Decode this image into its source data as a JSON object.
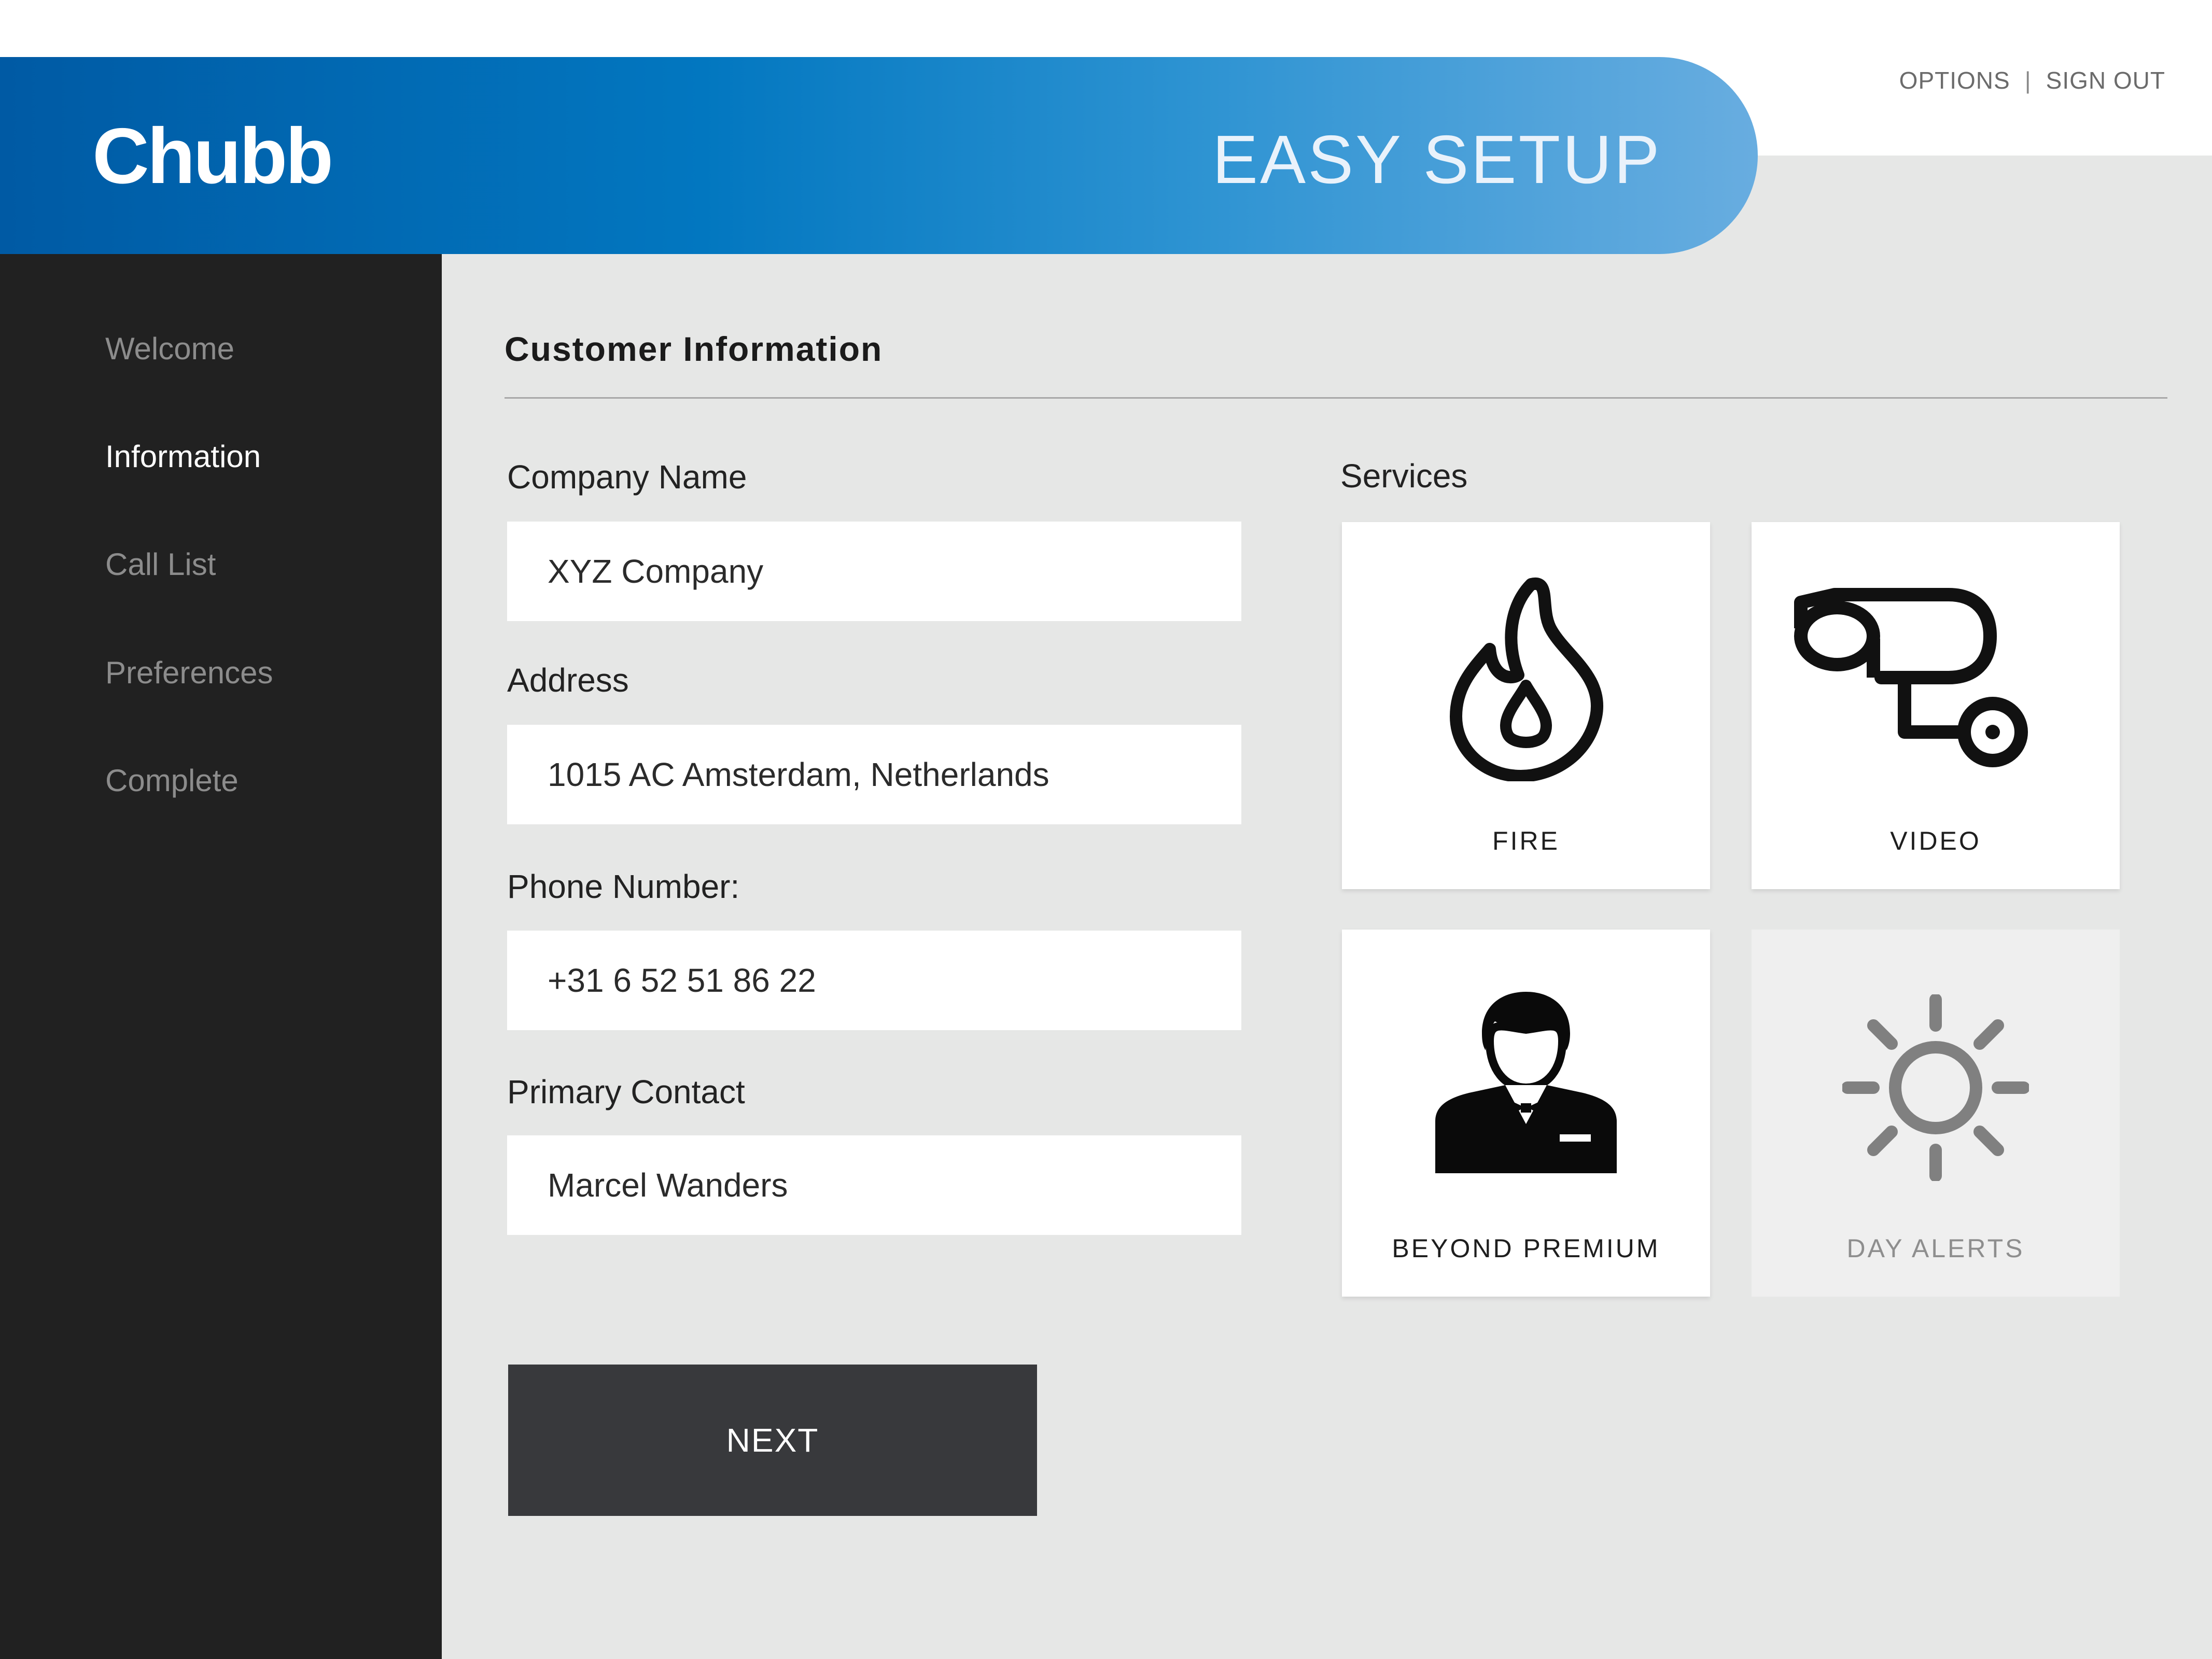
{
  "header": {
    "brand": "Chubb",
    "title": "EASY SETUP",
    "links": {
      "options": "OPTIONS",
      "separator": "|",
      "sign_out": "SIGN OUT"
    }
  },
  "sidebar": {
    "items": [
      {
        "label": "Welcome",
        "active": false
      },
      {
        "label": "Information",
        "active": true
      },
      {
        "label": "Call List",
        "active": false
      },
      {
        "label": "Preferences",
        "active": false
      },
      {
        "label": "Complete",
        "active": false
      }
    ]
  },
  "main": {
    "section_title": "Customer Information",
    "fields": [
      {
        "label": "Company Name",
        "value": "XYZ Company"
      },
      {
        "label": "Address",
        "value": "1015 AC Amsterdam, Netherlands"
      },
      {
        "label": "Phone Number:",
        "value": "+31 6 52 51 86 22"
      },
      {
        "label": "Primary Contact",
        "value": "Marcel Wanders"
      }
    ],
    "next_label": "NEXT"
  },
  "services": {
    "label": "Services",
    "tiles": [
      {
        "label": "FIRE",
        "icon": "fire-icon",
        "enabled": true
      },
      {
        "label": "VIDEO",
        "icon": "security-camera-icon",
        "enabled": true
      },
      {
        "label": "BEYOND PREMIUM",
        "icon": "concierge-icon",
        "enabled": true
      },
      {
        "label": "DAY ALERTS",
        "icon": "sun-icon",
        "enabled": false
      }
    ]
  },
  "colors": {
    "header_start": "#005aa4",
    "header_end": "#68ade0",
    "sidebar_bg": "#212121",
    "content_bg": "#e6e7e6",
    "button_bg": "#38393c",
    "disabled_text": "#8e8e8e"
  }
}
